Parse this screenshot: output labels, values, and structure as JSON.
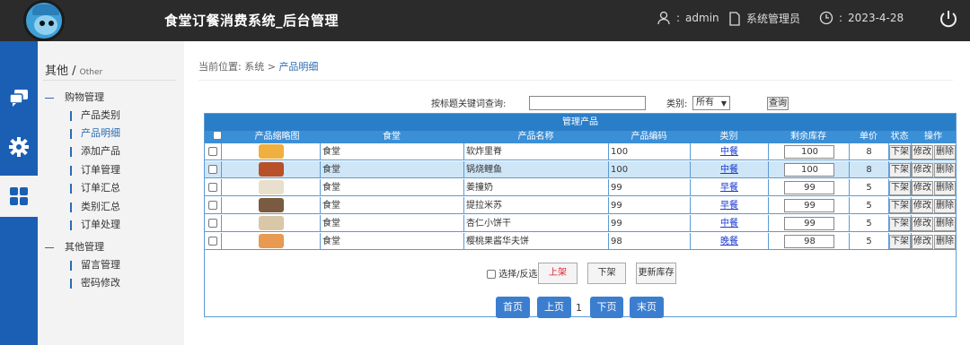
{
  "header": {
    "title": "食堂订餐消费系统_后台管理",
    "user": "admin",
    "role": "系统管理员",
    "date": "2023-4-28",
    "user_sep": ":",
    "date_sep": ":"
  },
  "sidebar": {
    "title": "其他",
    "title_sub": "Other",
    "groups": [
      {
        "label": "购物管理",
        "items": [
          "产品类别",
          "产品明细",
          "添加产品",
          "订单管理",
          "订单汇总",
          "类别汇总",
          "订单处理"
        ]
      },
      {
        "label": "其他管理",
        "items": [
          "留言管理",
          "密码修改"
        ]
      }
    ],
    "active_item": "产品明细"
  },
  "breadcrumb": {
    "prefix": "当前位置:",
    "root": "系统",
    "sep": ">",
    "current": "产品明细"
  },
  "search": {
    "label": "按标题关键词查询:",
    "value": "",
    "category_label": "类别:",
    "category_value": "所有",
    "button": "查询"
  },
  "table": {
    "title": "管理产品",
    "columns": [
      "",
      "产品缩略图",
      "食堂",
      "产品名称",
      "产品编码",
      "类别",
      "剩余库存",
      "单价",
      "状态",
      "操作"
    ],
    "rows": [
      {
        "canteen": "食堂",
        "name": "软炸里脊",
        "code": "100",
        "category": "中餐",
        "stock": "100",
        "price": "8",
        "thumb_color": "#f0b040"
      },
      {
        "canteen": "食堂",
        "name": "锅烧鲤鱼",
        "code": "100",
        "category": "中餐",
        "stock": "100",
        "price": "8",
        "thumb_color": "#b8502a"
      },
      {
        "canteen": "食堂",
        "name": "姜撞奶",
        "code": "99",
        "category": "早餐",
        "stock": "99",
        "price": "5",
        "thumb_color": "#e8e0cc"
      },
      {
        "canteen": "食堂",
        "name": "提拉米苏",
        "code": "99",
        "category": "早餐",
        "stock": "99",
        "price": "5",
        "thumb_color": "#7a5a40"
      },
      {
        "canteen": "食堂",
        "name": "杏仁小饼干",
        "code": "99",
        "category": "中餐",
        "stock": "99",
        "price": "5",
        "thumb_color": "#d9c8a8"
      },
      {
        "canteen": "食堂",
        "name": "樱桃果酱华夫饼",
        "code": "98",
        "category": "晚餐",
        "stock": "98",
        "price": "5",
        "thumb_color": "#e89a50"
      }
    ],
    "action_offline": "下架",
    "action_edit": "修改",
    "action_delete": "删除"
  },
  "bulk": {
    "select_label": "选择/反选",
    "online": "上架",
    "offline": "下架",
    "update_stock": "更新库存"
  },
  "pagination": {
    "first": "首页",
    "prev": "上页",
    "current": "1",
    "next": "下页",
    "last": "末页"
  },
  "colors": {
    "header_bg": "#2b2b2b",
    "rail_bg": "#1a5fb4",
    "table_head": "#2a7ec8",
    "highlight_row": "#cfe6f7",
    "page_btn": "#3b7ed0"
  }
}
